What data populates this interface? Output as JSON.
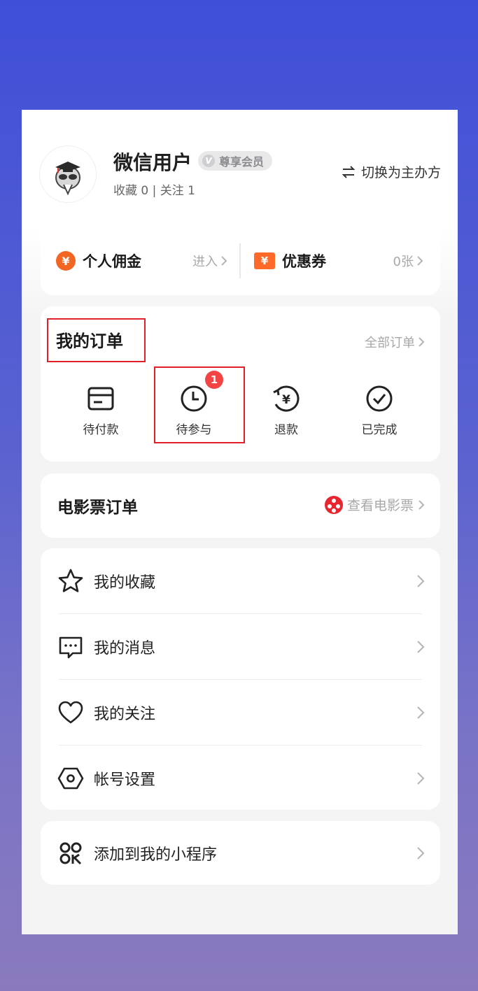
{
  "profile": {
    "username": "微信用户",
    "vip_icon": "V",
    "vip_label": "尊享会员",
    "stats": "收藏 0 | 关注 1",
    "switch_label": "切换为主办方",
    "switch_icon": "swap-arrows-icon",
    "avatar_icon": "graduate-panda-avatar"
  },
  "commission": {
    "left": {
      "icon": "¥",
      "label": "个人佣金",
      "action": "进入"
    },
    "right": {
      "icon": "¥",
      "label": "优惠券",
      "action": "0张"
    }
  },
  "orders": {
    "title": "我的订单",
    "all_label": "全部订单",
    "items": [
      {
        "label": "待付款",
        "icon": "card-icon"
      },
      {
        "label": "待参与",
        "icon": "clock-icon",
        "badge": "1"
      },
      {
        "label": "退款",
        "icon": "refund-icon",
        "symbol": "¥"
      },
      {
        "label": "已完成",
        "icon": "check-circle-icon"
      }
    ]
  },
  "movie": {
    "title": "电影票订单",
    "action": "查看电影票"
  },
  "menu": {
    "items": [
      {
        "label": "我的收藏",
        "icon": "star-icon"
      },
      {
        "label": "我的消息",
        "icon": "message-icon"
      },
      {
        "label": "我的关注",
        "icon": "heart-icon"
      },
      {
        "label": "帐号设置",
        "icon": "settings-icon"
      }
    ]
  },
  "mini_program": {
    "label": "添加到我的小程序",
    "icon": "mini-program-icon"
  },
  "colors": {
    "accent_orange": "#f26522",
    "badge_red": "#f24444",
    "highlight_red": "#e3202a",
    "background_top": "#3f4fd8",
    "background_bottom": "#8a7abd"
  }
}
